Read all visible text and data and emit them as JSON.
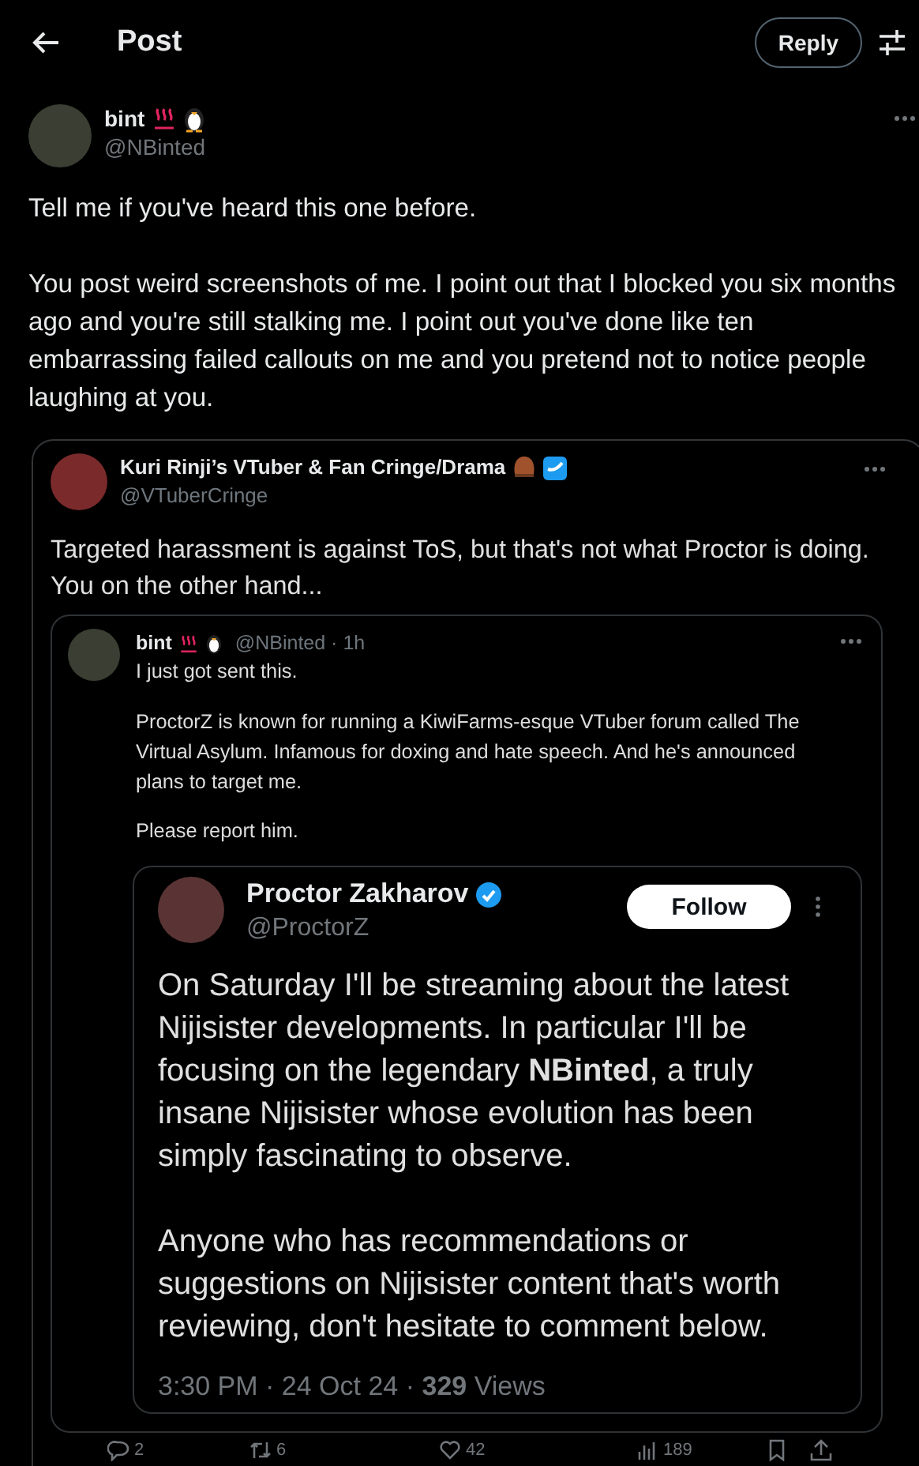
{
  "header": {
    "title": "Post",
    "reply_button": "Reply"
  },
  "post": {
    "name": "bint",
    "handle": "@NBinted",
    "paragraphs": [
      "Tell me if you've heard this one before.",
      "You post weird screenshots of me. I point out that I blocked you six months ago and you're still stalking me. I point out you've done like ten embarrassing failed callouts on me and you pretend not to notice people laughing at you."
    ]
  },
  "screenshot": {
    "name": "Kuri Rinji’s VTuber & Fan Cringe/Drama",
    "handle": "@VTuberCringe",
    "text": "Targeted harassment is against ToS, but that's not what Proctor is doing. You on the other hand...",
    "quoted": {
      "name": "bint",
      "meta": "@NBinted · 1h",
      "paragraphs": [
        "I just got sent this.",
        "ProctorZ is known for running a KiwiFarms-esque VTuber forum called The Virtual Asylum. Infamous for doxing and hate speech. And he's announced plans to target me.",
        "Please report him."
      ]
    },
    "embedded": {
      "name": "Proctor Zakharov",
      "handle": "@ProctorZ",
      "follow_button": "Follow",
      "paragraphs": [
        "On Saturday I'll be streaming about the latest Nijisister developments. In particular I'll be focusing on the legendary **NBinted**, a truly insane Nijisister whose evolution has been simply fascinating to observe.",
        "Anyone who has recommendations or suggestions on Nijisister content that's worth reviewing, don't hesitate to comment below."
      ],
      "meta": "3:30 PM · 24 Oct 24 · **329** Views"
    },
    "actions": [
      {
        "kind": "reply",
        "count": "2"
      },
      {
        "kind": "repost",
        "count": "6"
      },
      {
        "kind": "like",
        "count": "42"
      },
      {
        "kind": "views",
        "count": "189"
      },
      {
        "kind": "bookmark"
      },
      {
        "kind": "share"
      }
    ]
  }
}
